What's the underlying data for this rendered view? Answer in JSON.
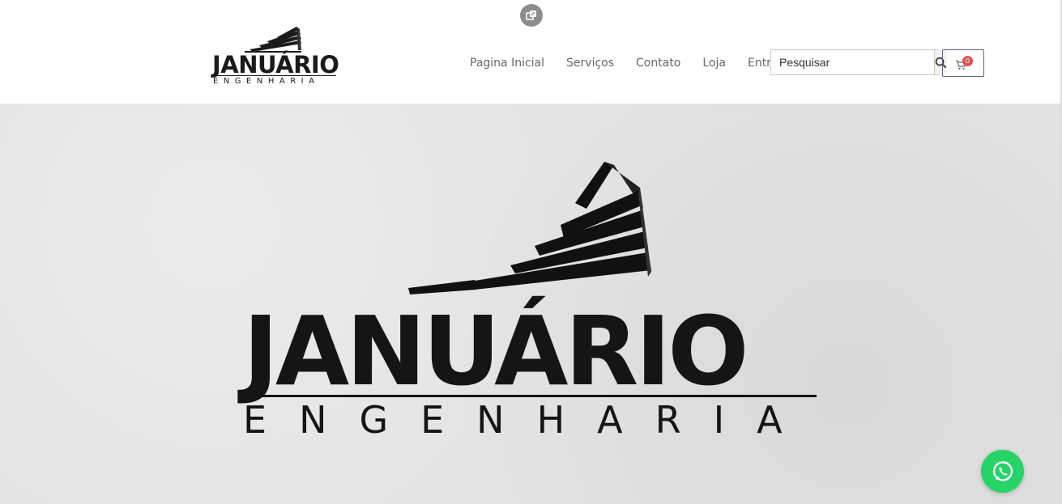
{
  "brand": {
    "name": "JANUÁRIO",
    "tagline": "ENGENHARIA"
  },
  "nav": {
    "items": [
      {
        "label": "Pagina Inicial"
      },
      {
        "label": "Serviços"
      },
      {
        "label": "Contato"
      },
      {
        "label": "Loja"
      },
      {
        "label": "Entrar"
      }
    ]
  },
  "search": {
    "placeholder": "Pesquisar",
    "button_icon": "search-icon"
  },
  "cart": {
    "icon": "cart-icon",
    "count": "0"
  },
  "hero": {
    "title": "JANUÁRIO",
    "subtitle": "ENGENHARIA"
  },
  "floating": {
    "top_icon": "external-link-icon",
    "chat_icon": "whatsapp-icon"
  },
  "colors": {
    "whatsapp": "#25d366",
    "badge": "#d9534f",
    "text": "#151515"
  }
}
